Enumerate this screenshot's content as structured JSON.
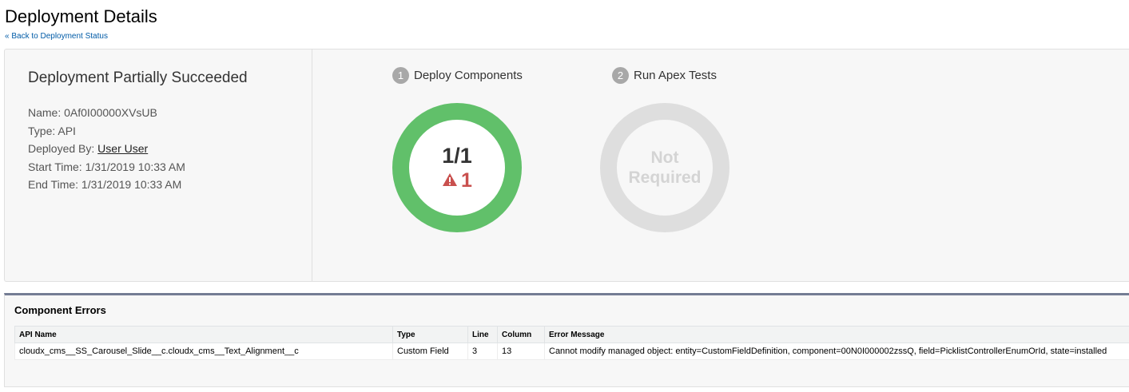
{
  "page": {
    "title": "Deployment Details",
    "back_link": "« Back to Deployment Status"
  },
  "summary": {
    "status": "Deployment Partially Succeeded",
    "name_label": "Name:",
    "name_value": "0Af0I00000XVsUB",
    "type_label": "Type:",
    "type_value": "API",
    "deployed_by_label": "Deployed By:",
    "deployed_by_value": "User User",
    "start_label": "Start Time:",
    "start_value": "1/31/2019 10:33 AM",
    "end_label": "End Time:",
    "end_value": "1/31/2019 10:33 AM"
  },
  "steps": [
    {
      "number": "1",
      "label": "Deploy Components",
      "count": "1/1",
      "warnings": "1",
      "progress": 1.0,
      "color": "#61c06a"
    },
    {
      "number": "2",
      "label": "Run Apex Tests",
      "status_line1": "Not",
      "status_line2": "Required",
      "color": "#dedede"
    }
  ],
  "errors": {
    "title": "Component Errors",
    "columns": [
      "API Name",
      "Type",
      "Line",
      "Column",
      "Error Message"
    ],
    "rows": [
      [
        "cloudx_cms__SS_Carousel_Slide__c.cloudx_cms__Text_Alignment__c",
        "Custom Field",
        "3",
        "13",
        "Cannot modify managed object: entity=CustomFieldDefinition, component=00N0I000002zssQ, field=PicklistControllerEnumOrId, state=installed"
      ]
    ]
  },
  "colors": {
    "success": "#61c06a",
    "warning": "#c9504e",
    "inactive": "#dedede",
    "link": "#015ba7"
  }
}
